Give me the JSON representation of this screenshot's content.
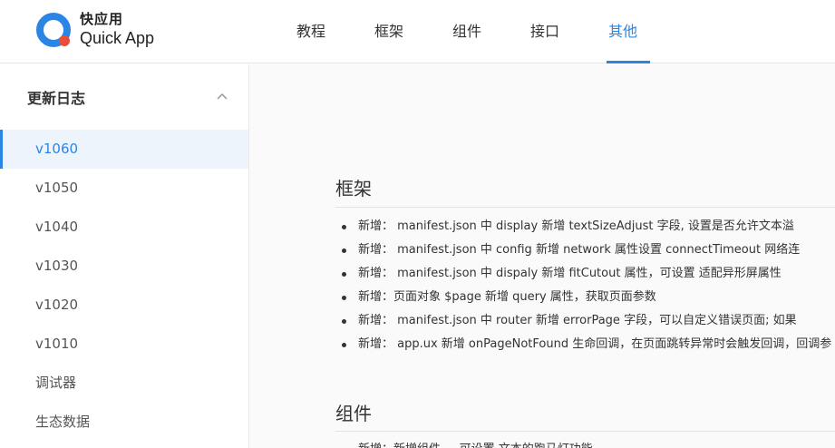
{
  "header": {
    "brand_cn": "快应用",
    "brand_en": "Quick App",
    "nav": [
      {
        "label": "教程",
        "active": false
      },
      {
        "label": "框架",
        "active": false
      },
      {
        "label": "组件",
        "active": false
      },
      {
        "label": "接口",
        "active": false
      },
      {
        "label": "其他",
        "active": true
      }
    ],
    "accent_color": "#2b85e4"
  },
  "sidebar": {
    "section_title": "更新日志",
    "items": [
      {
        "label": "v1060",
        "active": true
      },
      {
        "label": "v1050",
        "active": false
      },
      {
        "label": "v1040",
        "active": false
      },
      {
        "label": "v1030",
        "active": false
      },
      {
        "label": "v1020",
        "active": false
      },
      {
        "label": "v1010",
        "active": false
      },
      {
        "label": "调试器",
        "active": false
      },
      {
        "label": "生态数据",
        "active": false
      }
    ]
  },
  "main": {
    "framework": {
      "title": "框架",
      "items": [
        "新增： manifest.json 中 display 新增 textSizeAdjust 字段, 设置是否允许文本溢",
        "新增： manifest.json 中 config 新增 network 属性设置 connectTimeout 网络连",
        "新增： manifest.json 中 dispaly 新增 fitCutout 属性，可设置 适配异形屏属性",
        "新增：页面对象 $page 新增 query 属性，获取页面参数",
        "新增： manifest.json 中 router 新增 errorPage 字段，可以自定义错误页面; 如果",
        "新增： app.ux 新增 onPageNotFound 生命回调，在页面跳转异常时会触发回调，回调参"
      ]
    },
    "components": {
      "title": "组件",
      "items": [
        "新增：新增组件 ... 可设置 文本的跑马灯功能"
      ]
    }
  }
}
